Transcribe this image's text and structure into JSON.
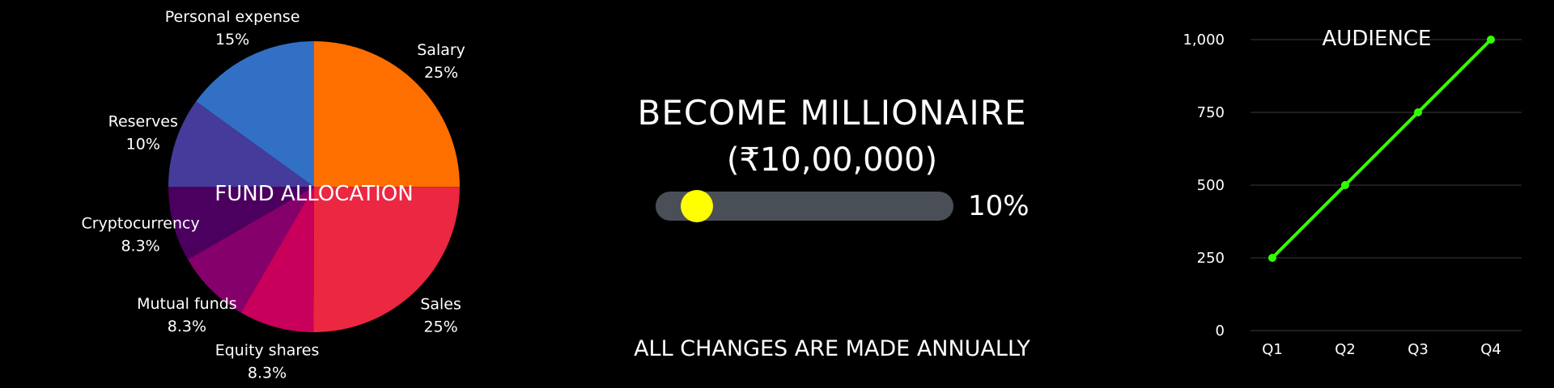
{
  "colors": {
    "background": "#000000",
    "text": "#ffffff",
    "progress_track": "#4a4f57",
    "progress_fill": "#ffff00",
    "line": "#33ff00",
    "grid": "#3a3a3a"
  },
  "goal": {
    "title": "BECOME MILLIONAIRE",
    "amount": "(₹10,00,000)",
    "progress": 0.1,
    "progress_label": "10%"
  },
  "footer": {
    "note": "ALL CHANGES ARE MADE ANNUALLY"
  },
  "chart_data": [
    {
      "type": "pie",
      "title": "FUND ALLOCATION",
      "start_angle_deg": 0,
      "direction": "clockwise",
      "slices": [
        {
          "label": "Salary",
          "value": 25,
          "value_label": "25%",
          "color": "#ff6f00"
        },
        {
          "label": "Sales",
          "value": 25,
          "value_label": "25%",
          "color": "#eb2742"
        },
        {
          "label": "Equity shares",
          "value": 8.3,
          "value_label": "8.3%",
          "color": "#c8005b"
        },
        {
          "label": "Mutual funds",
          "value": 8.3,
          "value_label": "8.3%",
          "color": "#86006c"
        },
        {
          "label": "Cryptocurrency",
          "value": 8.3,
          "value_label": "8.3%",
          "color": "#4b0060"
        },
        {
          "label": "Reserves",
          "value": 10,
          "value_label": "10%",
          "color": "#453b9a"
        },
        {
          "label": "Personal expense",
          "value": 15,
          "value_label": "15%",
          "color": "#3270c6"
        }
      ]
    },
    {
      "type": "line",
      "title": "AUDIENCE",
      "categories": [
        "Q1",
        "Q2",
        "Q3",
        "Q4"
      ],
      "series": [
        {
          "values": [
            250,
            500,
            750,
            1000
          ],
          "color": "#33ff00"
        }
      ],
      "ylim": [
        0,
        1000
      ],
      "yticks": [
        0,
        250,
        500,
        750,
        1000
      ],
      "ytick_labels": [
        "0",
        "250",
        "500",
        "750",
        "1,000"
      ],
      "grid": true,
      "legend": "none"
    }
  ]
}
